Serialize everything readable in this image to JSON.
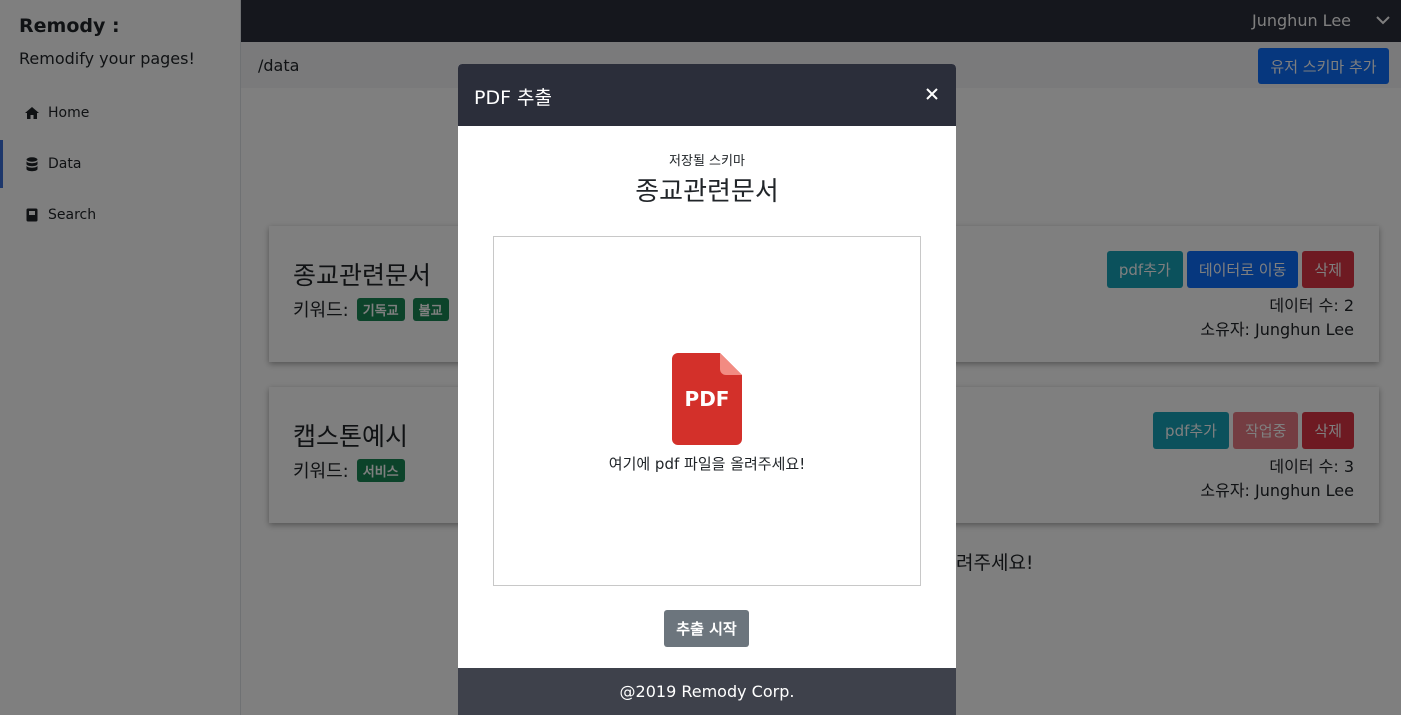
{
  "sidebar": {
    "brand_title": "Remody :",
    "brand_subtitle": "Remodify your pages!",
    "items": [
      {
        "label": "Home",
        "icon": "home-icon"
      },
      {
        "label": "Data",
        "icon": "database-icon",
        "active": true
      },
      {
        "label": "Search",
        "icon": "book-icon"
      }
    ]
  },
  "topbar": {
    "user_name": "Junghun Lee"
  },
  "page": {
    "breadcrumb": "/data",
    "add_schema_label": "유저 스키마 추가"
  },
  "cards": [
    {
      "title": "종교관련문서",
      "keywords_label": "키워드:",
      "keywords": [
        "기독교",
        "불교"
      ],
      "actions": {
        "pdf": "pdf추가",
        "move": "데이터로 이동",
        "delete": "삭제"
      },
      "count": "데이터 수: 2",
      "owner": "소유자: Junghun Lee"
    },
    {
      "title": "캡스톤예시",
      "keywords_label": "키워드:",
      "keywords": [
        "서비스"
      ],
      "actions": {
        "pdf": "pdf추가",
        "working": "작업중",
        "delete": "삭제"
      },
      "count": "데이터 수: 3",
      "owner": "소유자: Junghun Lee"
    }
  ],
  "background_hint": "려주세요!",
  "modal": {
    "title": "PDF 추출",
    "schema_label": "저장될 스키마",
    "schema_name": "종교관련문서",
    "pdf_icon_text": "PDF",
    "drop_text": "여기에 pdf 파일을 올려주세요!",
    "start_label": "추출 시작",
    "footer": "@2019 Remody Corp."
  },
  "colors": {
    "primary": "#0d6efd",
    "info": "#17a2b8",
    "danger": "#dc3545",
    "success": "#198754",
    "secondary": "#6c757d",
    "dark": "#2b2e3a"
  }
}
